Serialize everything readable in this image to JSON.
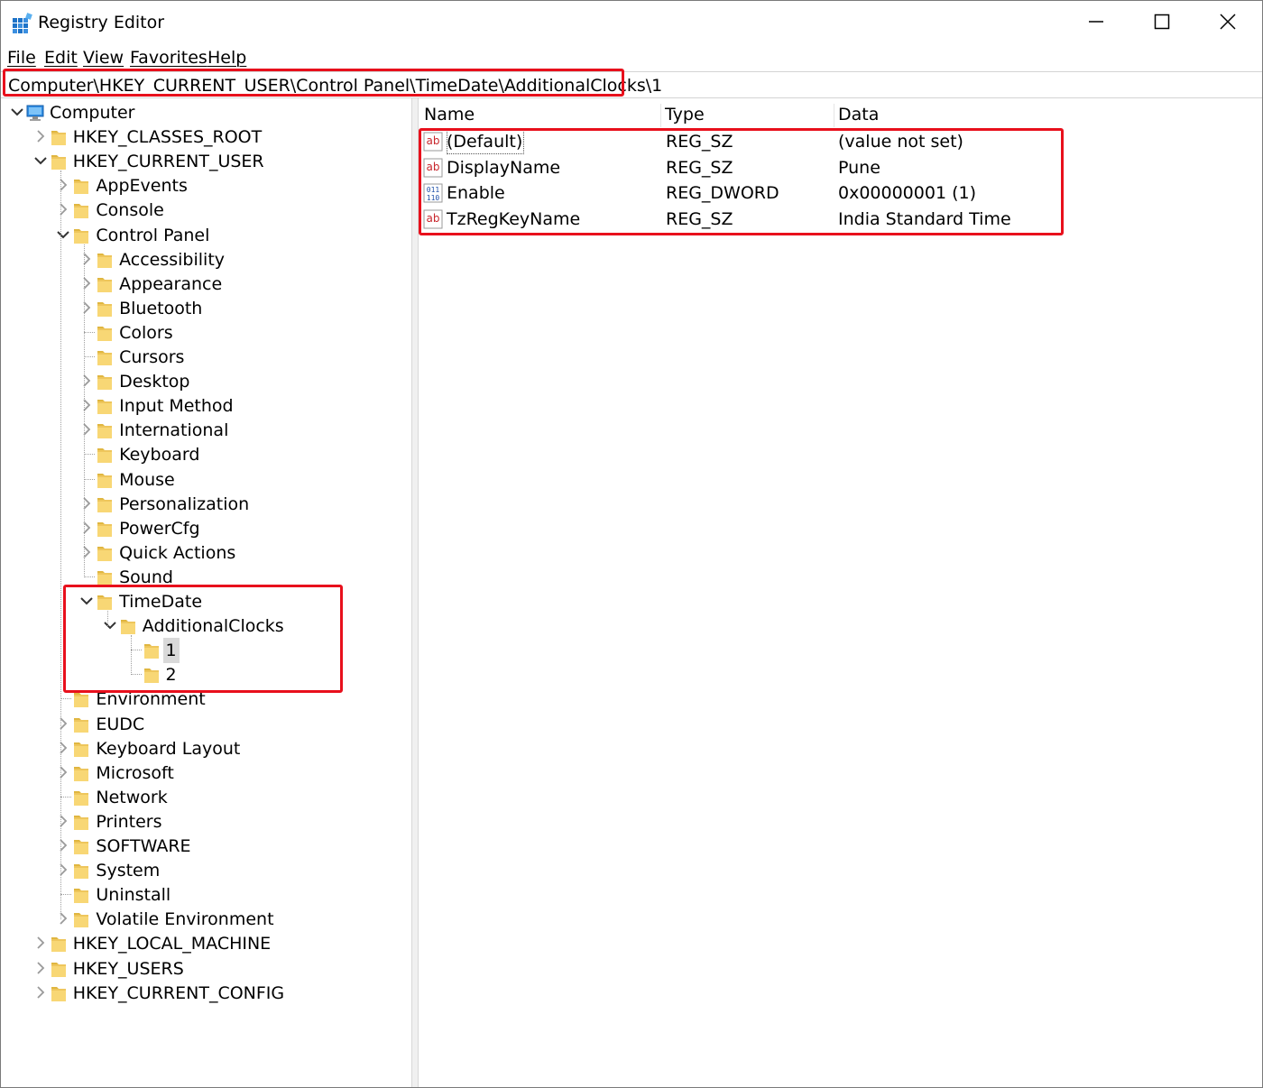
{
  "window": {
    "title": "Registry Editor"
  },
  "menu": [
    "File",
    "Edit",
    "View",
    "Favorites",
    "Help"
  ],
  "address": "Computer\\HKEY_CURRENT_USER\\Control Panel\\TimeDate\\AdditionalClocks\\1",
  "tree": [
    {
      "label": "Computer",
      "icon": "computer-icon",
      "expanded": true
    },
    {
      "label": "HKEY_CLASSES_ROOT"
    },
    {
      "label": "HKEY_CURRENT_USER",
      "expanded": true
    },
    {
      "label": "AppEvents"
    },
    {
      "label": "Console"
    },
    {
      "label": "Control Panel",
      "expanded": true
    },
    {
      "label": "Accessibility"
    },
    {
      "label": "Appearance"
    },
    {
      "label": "Bluetooth"
    },
    {
      "label": "Colors"
    },
    {
      "label": "Cursors"
    },
    {
      "label": "Desktop"
    },
    {
      "label": "Input Method"
    },
    {
      "label": "International"
    },
    {
      "label": "Keyboard"
    },
    {
      "label": "Mouse"
    },
    {
      "label": "Personalization"
    },
    {
      "label": "PowerCfg"
    },
    {
      "label": "Quick Actions"
    },
    {
      "label": "Sound"
    },
    {
      "label": "TimeDate",
      "expanded": true
    },
    {
      "label": "AdditionalClocks",
      "expanded": true
    },
    {
      "label": "1",
      "selected": true
    },
    {
      "label": "2"
    },
    {
      "label": "Environment"
    },
    {
      "label": "EUDC"
    },
    {
      "label": "Keyboard Layout"
    },
    {
      "label": "Microsoft"
    },
    {
      "label": "Network"
    },
    {
      "label": "Printers"
    },
    {
      "label": "SOFTWARE"
    },
    {
      "label": "System"
    },
    {
      "label": "Uninstall"
    },
    {
      "label": "Volatile Environment"
    },
    {
      "label": "HKEY_LOCAL_MACHINE"
    },
    {
      "label": "HKEY_USERS"
    },
    {
      "label": "HKEY_CURRENT_CONFIG"
    }
  ],
  "values": {
    "columns": [
      "Name",
      "Type",
      "Data"
    ],
    "rows": [
      {
        "name": "(Default)",
        "type": "REG_SZ",
        "data": "(value not set)",
        "icon": "string-value-icon"
      },
      {
        "name": "DisplayName",
        "type": "REG_SZ",
        "data": "Pune",
        "icon": "string-value-icon"
      },
      {
        "name": "Enable",
        "type": "REG_DWORD",
        "data": "0x00000001 (1)",
        "icon": "binary-value-icon"
      },
      {
        "name": "TzRegKeyName",
        "type": "REG_SZ",
        "data": "India Standard Time",
        "icon": "string-value-icon"
      }
    ]
  },
  "colors": {
    "highlight": "#e8101c",
    "selection": "#d9d9d9",
    "folder": "#f8d775"
  }
}
